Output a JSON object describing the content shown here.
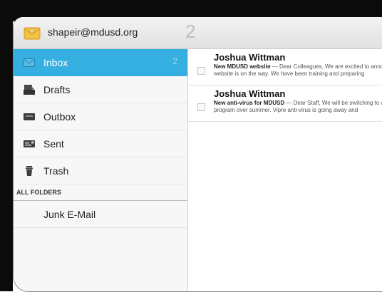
{
  "account": {
    "email": "shapeir@mdusd.org",
    "unread_count": "2",
    "icon": "envelope-at-icon"
  },
  "sidebar": {
    "folders": [
      {
        "label": "Inbox",
        "count": "2",
        "icon": "inbox-icon",
        "active": true
      },
      {
        "label": "Drafts",
        "icon": "drafts-icon"
      },
      {
        "label": "Outbox",
        "icon": "outbox-icon"
      },
      {
        "label": "Sent",
        "icon": "sent-icon"
      },
      {
        "label": "Trash",
        "icon": "trash-icon"
      }
    ],
    "section_header": "ALL FOLDERS",
    "other_folders": [
      {
        "label": "Junk E-Mail"
      }
    ]
  },
  "messages": [
    {
      "sender": "Joshua Wittman",
      "subject": "New MDUSD website",
      "preview_line1": " — Dear Colleagues, We are excited to announce that a new",
      "preview_line2": "website is on the way. We have been training and preparing"
    },
    {
      "sender": "Joshua Wittman",
      "subject": "New anti-virus for MDUSD",
      "preview_line1": " — Dear Staff, We will be switching to a new anti-virus",
      "preview_line2": "program over summer. Vipre anti-virus is going away and"
    }
  ],
  "colors": {
    "accent": "#35aee0",
    "frame": "#0b0b0b"
  }
}
